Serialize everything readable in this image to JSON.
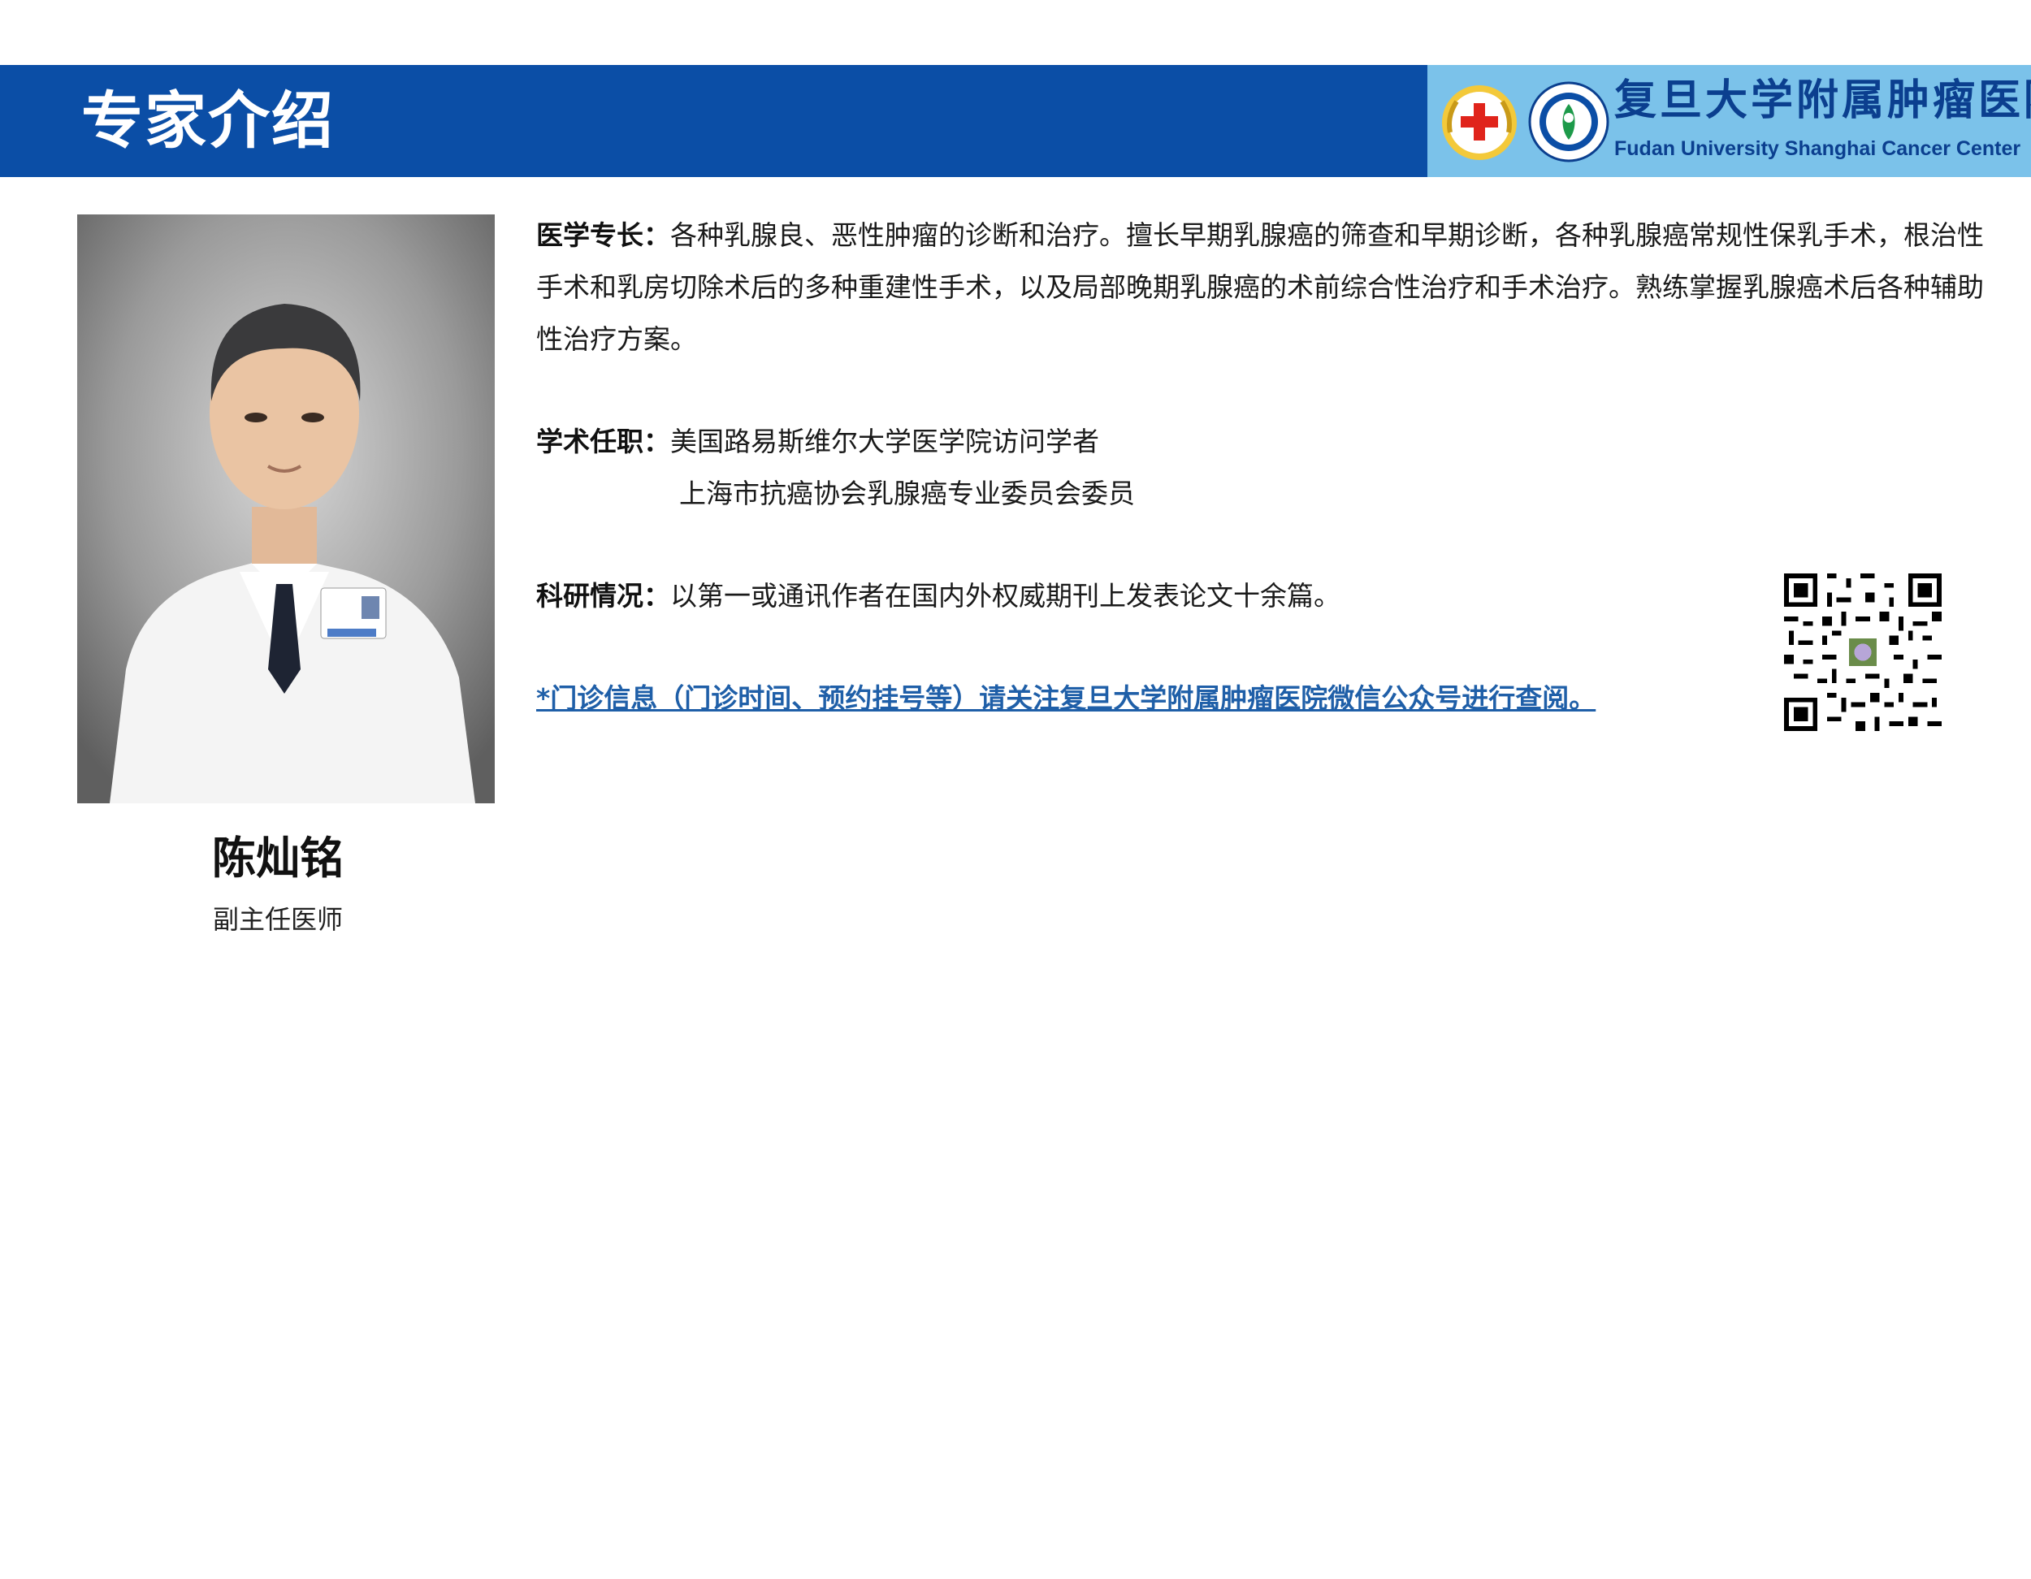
{
  "header": {
    "title": "专家介绍",
    "hospital_name_cn": "复旦大学附属肿瘤医院",
    "hospital_name_en": "Fudan University Shanghai Cancer Center",
    "bar_color": "#0b4ea6",
    "logo_bg_color": "#7bc2ea"
  },
  "doctor": {
    "name": "陈灿铭",
    "title": "副主任医师",
    "photo": "doctor-portrait"
  },
  "specialty": {
    "label": "医学专长：",
    "text": "各种乳腺良、恶性肿瘤的诊断和治疗。擅长早期乳腺癌的筛查和早期诊断，各种乳腺癌常规性保乳手术，根治性手术和乳房切除术后的多种重建性手术，以及局部晚期乳腺癌的术前综合性治疗和手术治疗。熟练掌握乳腺癌术后各种辅助性治疗方案。"
  },
  "academic": {
    "label": "学术任职：",
    "items": [
      "美国路易斯维尔大学医学院访问学者",
      "上海市抗癌协会乳腺癌专业委员会委员"
    ]
  },
  "research": {
    "label": "科研情况：",
    "text": "以第一或通讯作者在国内外权威期刊上发表论文十余篇。"
  },
  "notice": {
    "text": "*门诊信息（门诊时间、预约挂号等）请关注复旦大学附属肿瘤医院微信公众号进行查阅。",
    "color": "#1f5fa8"
  },
  "qr_code": {
    "icon": "wechat-qr-code"
  }
}
